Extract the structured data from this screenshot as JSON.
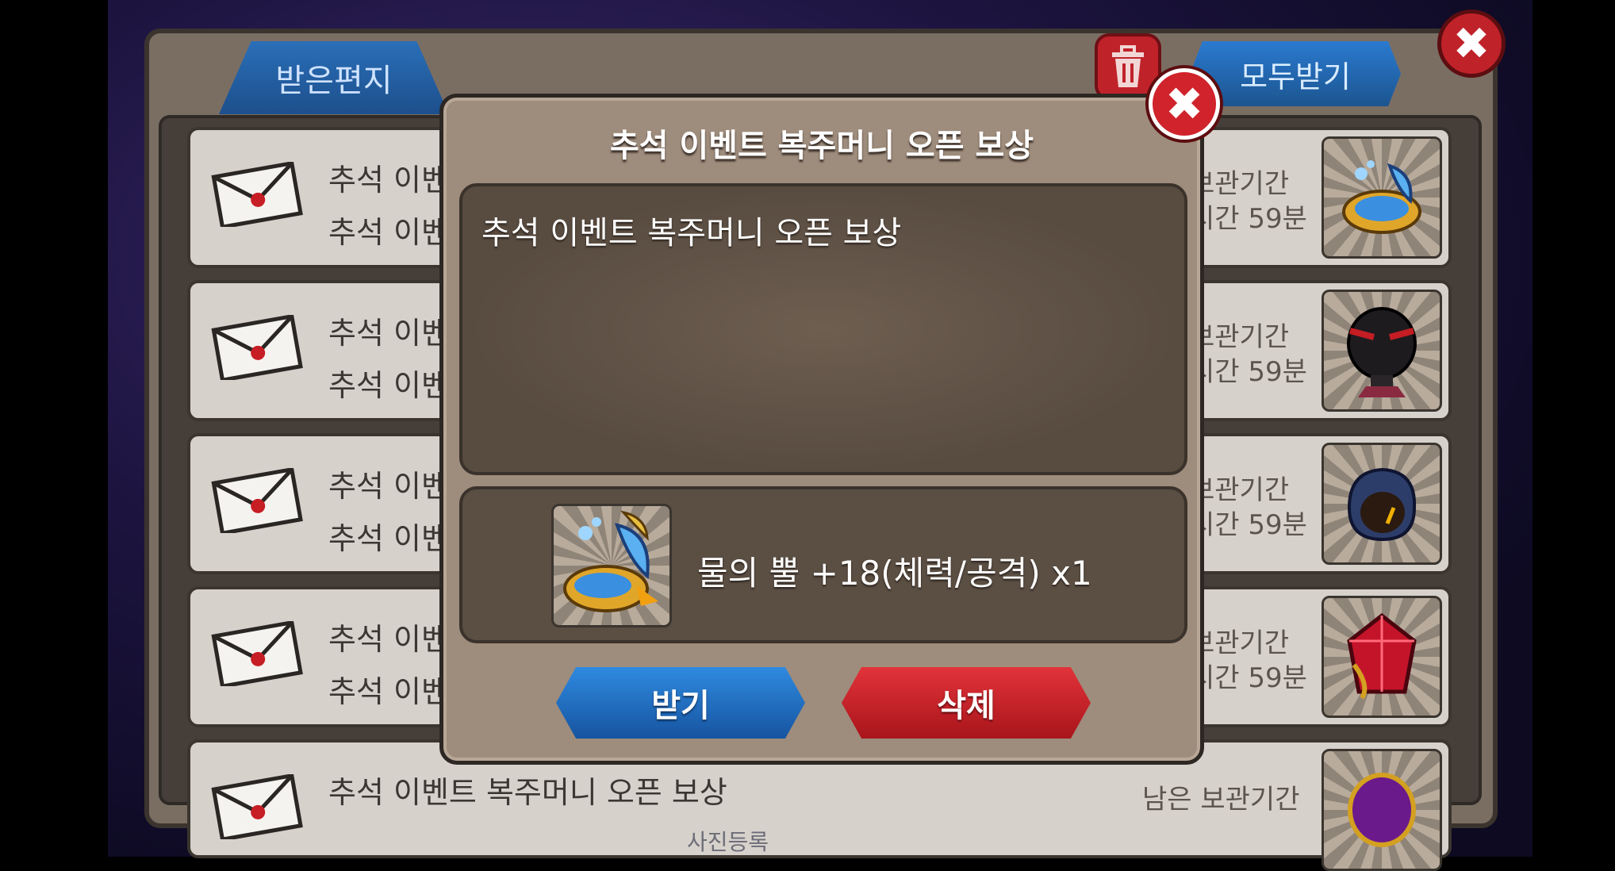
{
  "mailbox": {
    "tab_label": "받은편지",
    "receive_all_label": "모두받기",
    "rows": [
      {
        "subject": "추석 이벤",
        "sub": "추석 이벤",
        "expiry_label": "보관기간",
        "expiry_time": "시간 59분",
        "thumb_icon": "water-pearl-icon"
      },
      {
        "subject": "추석 이벤",
        "sub": "추석 이벤",
        "expiry_label": "보관기간",
        "expiry_time": "시간 59분",
        "thumb_icon": "dark-armor-icon"
      },
      {
        "subject": "추석 이벤",
        "sub": "추석 이벤",
        "expiry_label": "보관기간",
        "expiry_time": "시간 59분",
        "thumb_icon": "hooded-figure-icon"
      },
      {
        "subject": "추석 이벤",
        "sub": "추석 이벤",
        "expiry_label": "보관기간",
        "expiry_time": "시간 59분",
        "thumb_icon": "red-gem-icon"
      },
      {
        "subject": "추석 이벤트 복주머니 오픈 보상",
        "sub": "",
        "expiry_label": "남은 보관기간",
        "expiry_time": "",
        "thumb_icon": "purple-orb-icon"
      }
    ]
  },
  "bottom_label": "사진등록",
  "modal": {
    "title": "추석 이벤트 복주머니 오픈 보상",
    "message": "추석 이벤트 복주머니 오픈 보상",
    "reward_text": "물의 뿔 +18(체력/공격) x1",
    "receive_label": "받기",
    "delete_label": "삭제"
  },
  "colors": {
    "accent_blue": "#1f6fc0",
    "accent_red": "#c0222a"
  }
}
